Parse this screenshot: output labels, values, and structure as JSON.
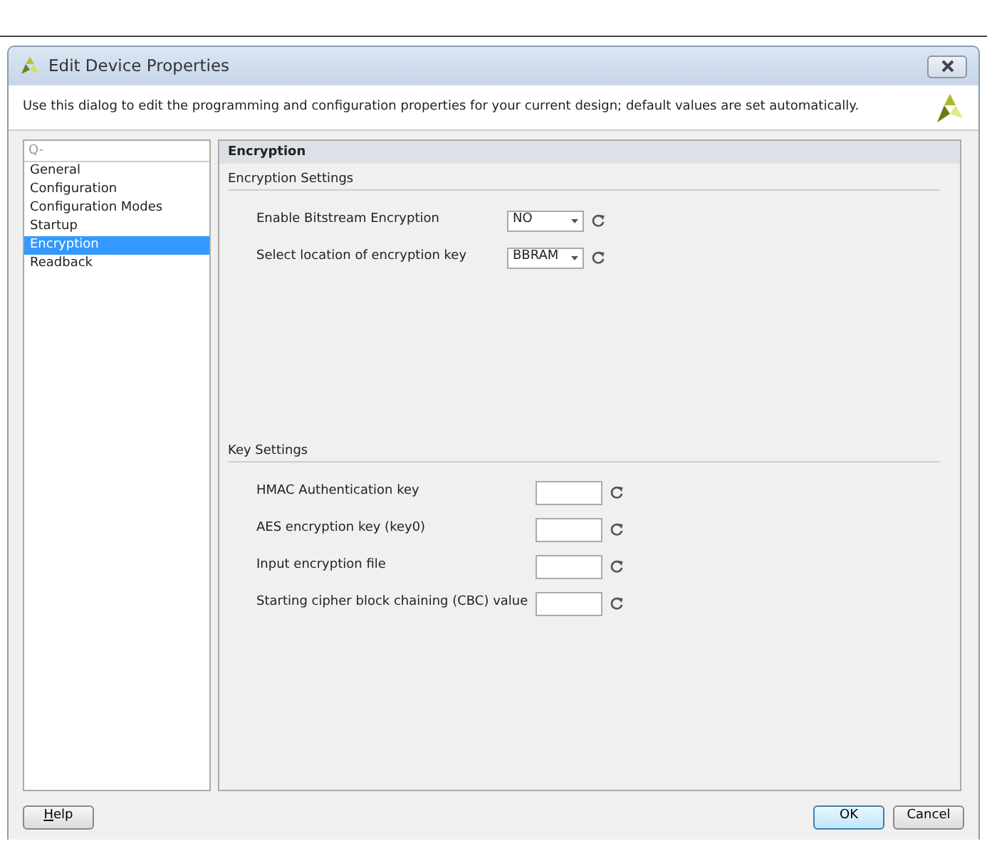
{
  "window": {
    "title": "Edit Device Properties"
  },
  "description": "Use this dialog to edit the programming and configuration properties for your current design; default values are set automatically.",
  "sidebar": {
    "search": {
      "placeholder": "Q-"
    },
    "items": [
      {
        "label": "General",
        "selected": false
      },
      {
        "label": "Configuration",
        "selected": false
      },
      {
        "label": "Configuration Modes",
        "selected": false
      },
      {
        "label": "Startup",
        "selected": false
      },
      {
        "label": "Encryption",
        "selected": true
      },
      {
        "label": "Readback",
        "selected": false
      }
    ]
  },
  "panel": {
    "title": "Encryption",
    "sections": [
      {
        "title": "Encryption Settings",
        "rows": [
          {
            "kind": "select",
            "label": "Enable Bitstream Encryption",
            "value": "NO"
          },
          {
            "kind": "select",
            "label": "Select location of encryption key",
            "value": "BBRAM"
          }
        ]
      },
      {
        "title": "Key Settings",
        "rows": [
          {
            "kind": "text",
            "label": "HMAC Authentication key"
          },
          {
            "kind": "text",
            "label": "AES encryption key (key0)"
          },
          {
            "kind": "text",
            "label": "Input encryption file"
          },
          {
            "kind": "text",
            "label": "Starting cipher block chaining (CBC) value"
          }
        ]
      }
    ]
  },
  "buttons": {
    "help": "Help",
    "ok": "OK",
    "cancel": "Cancel"
  }
}
